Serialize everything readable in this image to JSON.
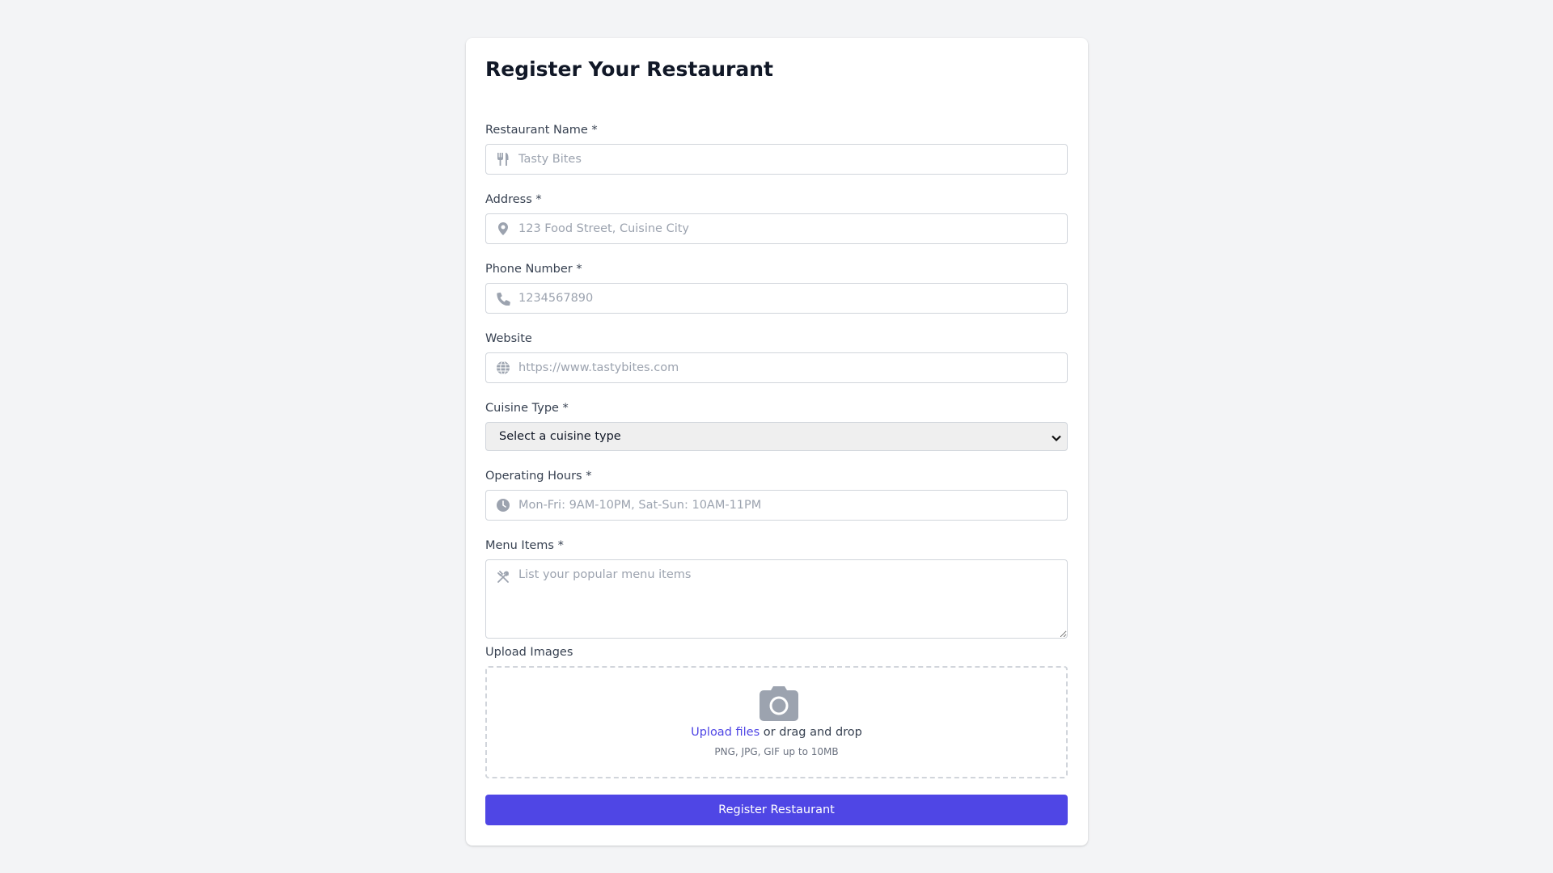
{
  "form": {
    "title": "Register Your Restaurant",
    "fields": {
      "name": {
        "label": "Restaurant Name *",
        "placeholder": "Tasty Bites",
        "value": "",
        "icon": "utensils-icon"
      },
      "address": {
        "label": "Address *",
        "placeholder": "123 Food Street, Cuisine City",
        "value": "",
        "icon": "map-pin-icon"
      },
      "phone": {
        "label": "Phone Number *",
        "placeholder": "1234567890",
        "value": "",
        "icon": "phone-icon"
      },
      "website": {
        "label": "Website",
        "placeholder": "https://www.tastybites.com",
        "value": "",
        "icon": "globe-icon"
      },
      "cuisine": {
        "label": "Cuisine Type *",
        "selected": "Select a cuisine type"
      },
      "hours": {
        "label": "Operating Hours *",
        "placeholder": "Mon-Fri: 9AM-10PM, Sat-Sun: 10AM-11PM",
        "value": "",
        "icon": "clock-icon"
      },
      "menu": {
        "label": "Menu Items *",
        "placeholder": "List your popular menu items",
        "value": "",
        "icon": "fork-knife-icon"
      },
      "images": {
        "label": "Upload Images",
        "icon": "camera-icon",
        "upload_link": "Upload files",
        "upload_rest": " or drag and drop",
        "hint": "PNG, JPG, GIF up to 10MB"
      }
    },
    "submit_label": "Register Restaurant"
  },
  "colors": {
    "background": "#f3f4f6",
    "card": "#ffffff",
    "accent": "#4f46e5",
    "icon": "#9ca3af",
    "border": "#d1d5db"
  }
}
